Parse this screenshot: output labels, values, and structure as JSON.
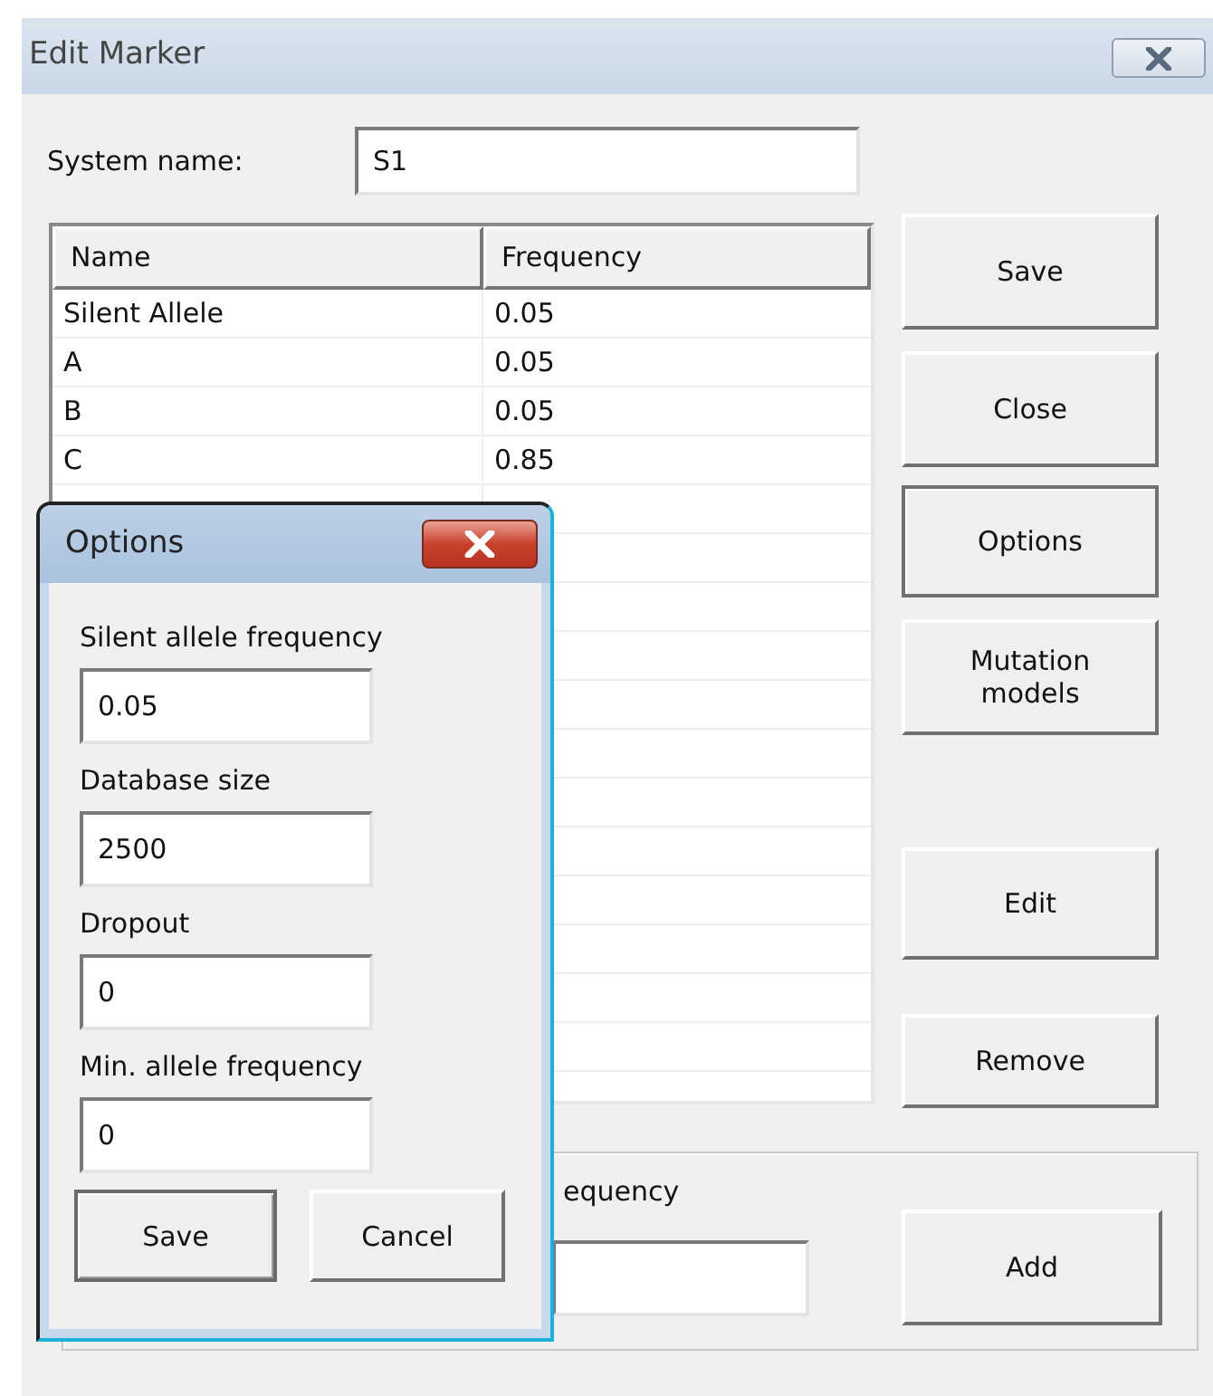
{
  "window": {
    "title": "Edit Marker"
  },
  "system_name": {
    "label": "System name:",
    "value": "S1"
  },
  "table": {
    "columns": [
      "Name",
      "Frequency"
    ],
    "rows": [
      [
        "Silent Allele",
        "0.05"
      ],
      [
        "A",
        "0.05"
      ],
      [
        "B",
        "0.05"
      ],
      [
        "C",
        "0.85"
      ]
    ]
  },
  "side_buttons": [
    "Save",
    "Close",
    "Options",
    "Mutation models",
    "Edit",
    "Remove"
  ],
  "add_group": {
    "label": "equency",
    "button": "Add"
  },
  "options_dialog": {
    "title": "Options",
    "fields": [
      {
        "label": "Silent allele frequency",
        "value": "0.05"
      },
      {
        "label": "Database size",
        "value": "2500"
      },
      {
        "label": "Dropout",
        "value": "0"
      },
      {
        "label": "Min. allele frequency",
        "value": "0"
      }
    ],
    "buttons": [
      {
        "label": "Save",
        "default": true
      },
      {
        "label": "Cancel",
        "default": false
      }
    ]
  }
}
